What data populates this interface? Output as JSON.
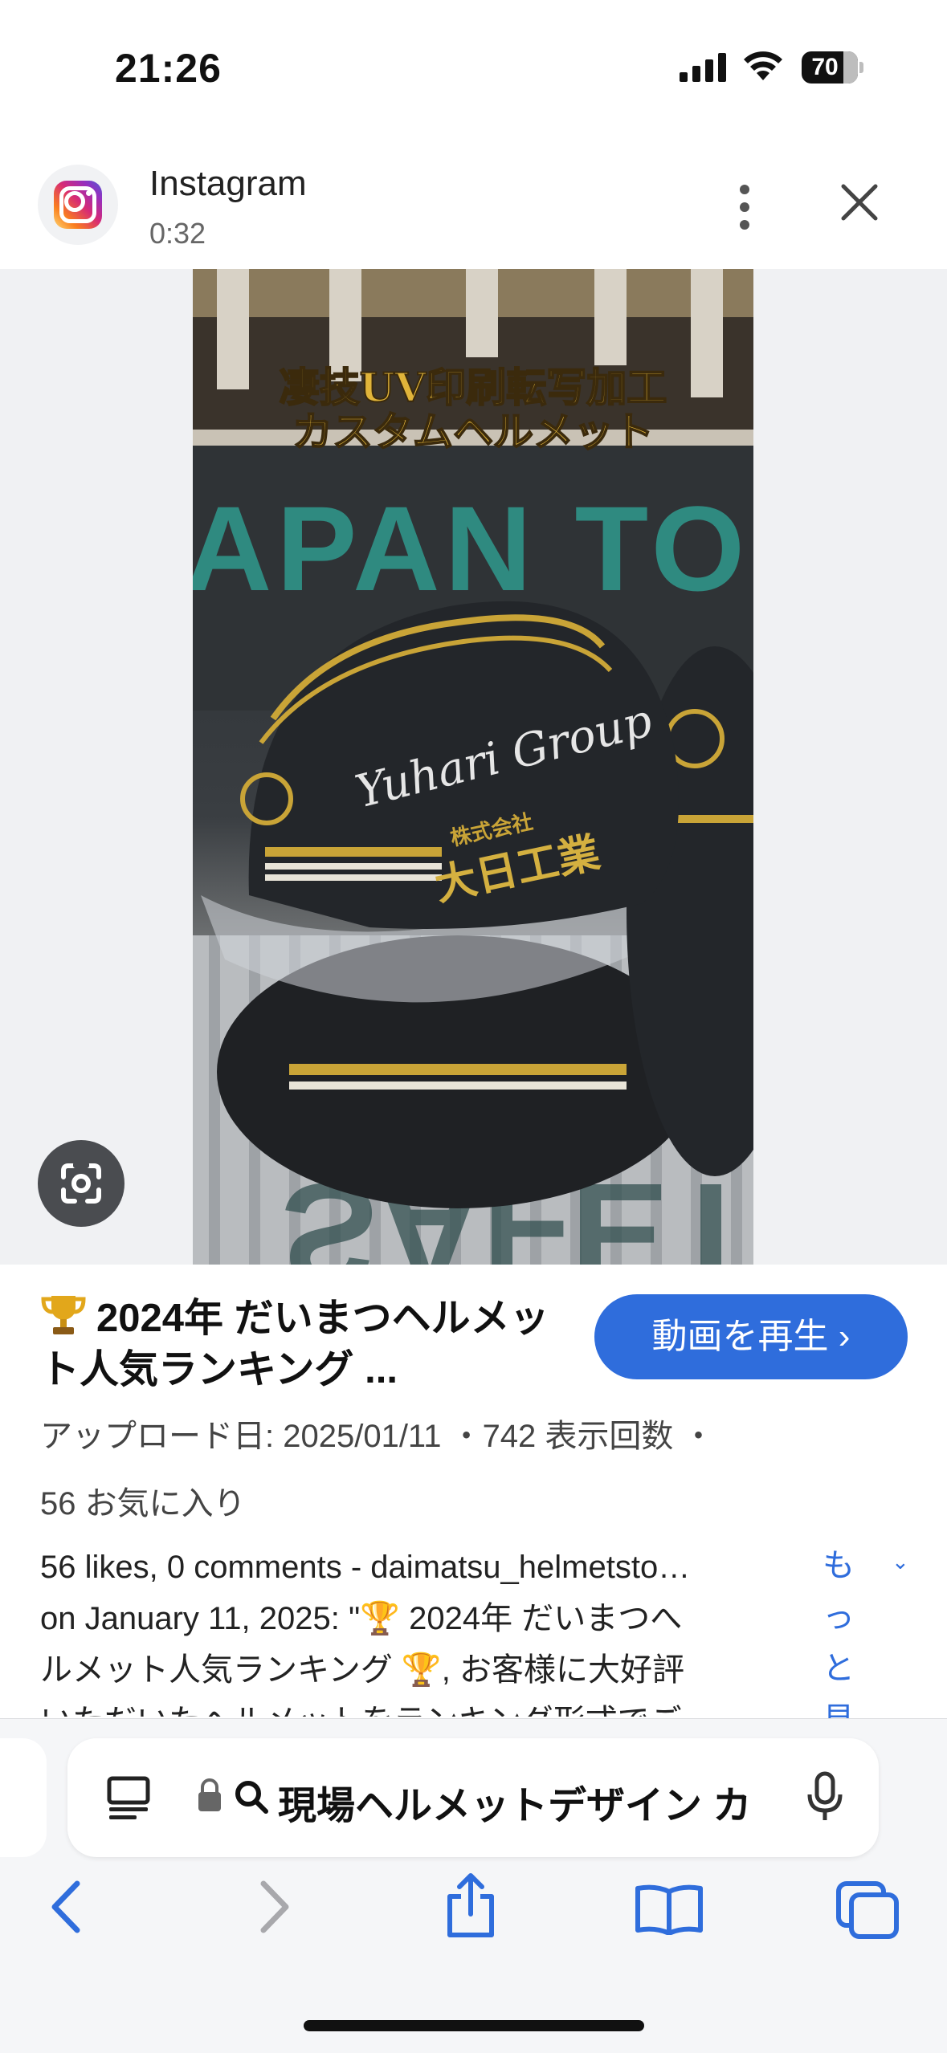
{
  "status_bar": {
    "time": "21:26",
    "battery": "70"
  },
  "header": {
    "app_name": "Instagram",
    "duration": "0:32"
  },
  "media": {
    "overlay_text": [
      "凄技UV印刷転写加工",
      "カスタムヘルメット"
    ],
    "background_text": "APAN TO T",
    "helmet_script": "Yuhari Group",
    "helmet_company_small": "株式会社",
    "helmet_company": "大日工業"
  },
  "result": {
    "title": "2024年 だいまつヘルメット人気ランキング ...",
    "play_button": "動画を再生 ›",
    "meta_upload": "アップロード日: 2025/01/11 ・742 表示回数 ・",
    "meta_favorites": "56 お気に入り",
    "description_lines": [
      "56 likes, 0 comments - daimatsu_helmetsto…",
      "on January 11, 2025: \"🏆 2024年 だいまつへ",
      "ルメット人気ランキング 🏆, お客様に大好評",
      "いただいたヘルメットをランキング形式でご"
    ],
    "more_label": "もっと見",
    "accent_color": "#2f6ddc"
  },
  "toolbar": {
    "address_text": "現場ヘルメットデザイン カ"
  }
}
